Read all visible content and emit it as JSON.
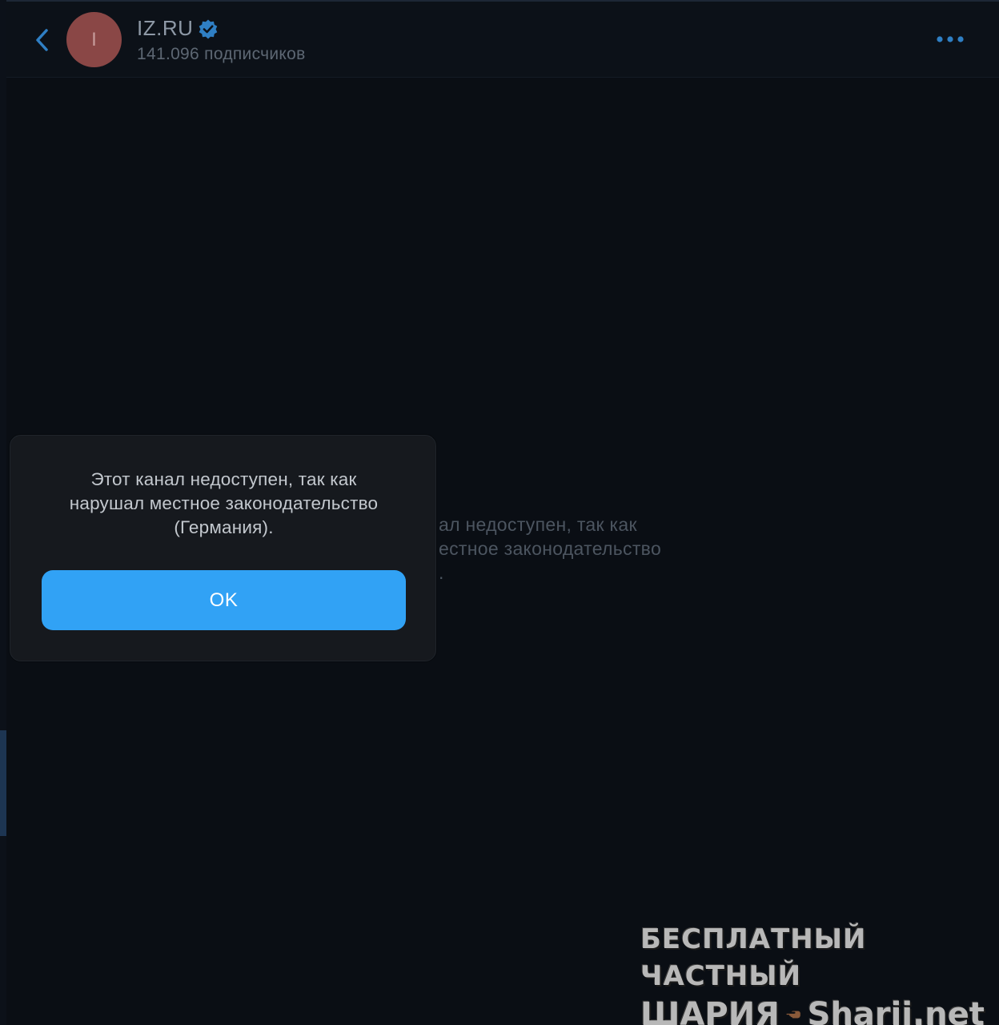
{
  "header": {
    "avatar_letter": "I",
    "channel_title": "IZ.RU",
    "subscribers": "141.096 подписчиков"
  },
  "background_message": {
    "lines": [
      "ал недоступен, так как",
      "естное законодательство",
      "."
    ]
  },
  "dialog": {
    "message": "Этот канал недоступен, так как\nнарушал местное законодательство\n(Германия).",
    "ok_label": "OK"
  },
  "watermark": {
    "line1": "БЕСПЛАТНЫЙ ЧАСТНЫЙ",
    "line2_left": "ШАРИЯ",
    "line2_right": "Sharij.net"
  },
  "icons": {
    "back": "chevron-left-icon",
    "verified": "verified-badge-icon",
    "more": "more-dots-icon",
    "watermark_hand": "pointing-hand-icon"
  },
  "colors": {
    "accent": "#31a2f5",
    "avatar": "#8a4746",
    "background": "#0a0e14",
    "dialog": "#16191e"
  }
}
